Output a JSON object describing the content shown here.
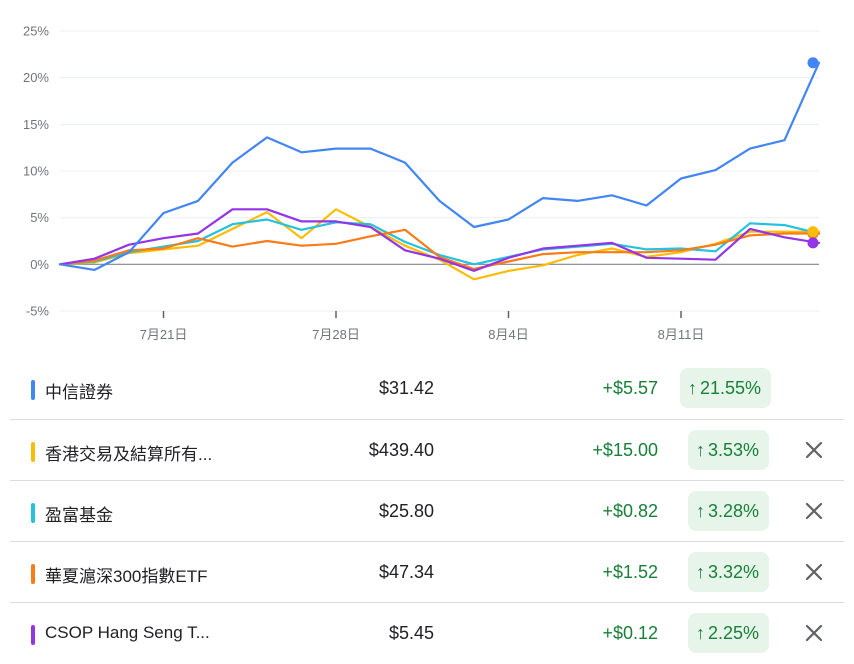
{
  "chart_data": {
    "type": "line",
    "y_tick_labels": [
      "25%",
      "20%",
      "15%",
      "10%",
      "5%",
      "0%",
      "-5%"
    ],
    "y_ticks": [
      25,
      20,
      15,
      10,
      5,
      0,
      -5
    ],
    "ylim": [
      -5,
      25
    ],
    "x_tick_labels": [
      "7月21日",
      "7月28日",
      "8月4日",
      "8月11日"
    ],
    "x_tick_index": [
      3,
      8,
      13,
      18
    ],
    "x_count": 23,
    "grid": true,
    "series": [
      {
        "name": "中信證券",
        "color": "#4285f4",
        "values": [
          0,
          -0.6,
          1.3,
          5.5,
          6.8,
          10.9,
          13.6,
          12.0,
          12.4,
          12.4,
          10.9,
          6.8,
          4.0,
          4.8,
          7.1,
          6.8,
          7.4,
          6.3,
          9.2,
          10.1,
          12.4,
          13.3,
          21.6
        ]
      },
      {
        "name": "香港交易及結算所有...",
        "color": "#fbbc04",
        "values": [
          0,
          0.2,
          1.2,
          1.6,
          2.0,
          3.8,
          5.6,
          2.8,
          5.9,
          4.0,
          2.0,
          0.5,
          -1.6,
          -0.7,
          -0.1,
          1.0,
          1.7,
          0.8,
          1.3,
          2.2,
          3.5,
          3.5,
          3.5
        ]
      },
      {
        "name": "盈富基金",
        "color": "#24c1e0",
        "values": [
          0,
          0.3,
          1.3,
          1.9,
          2.5,
          4.3,
          4.8,
          3.7,
          4.5,
          4.3,
          2.4,
          1.0,
          0.0,
          0.8,
          1.6,
          1.9,
          2.2,
          1.6,
          1.7,
          1.4,
          4.4,
          4.2,
          3.3
        ]
      },
      {
        "name": "華夏滬深300指數ETF",
        "color": "#fa7b17",
        "values": [
          0,
          0.4,
          1.5,
          1.7,
          2.8,
          1.9,
          2.5,
          2.0,
          2.2,
          3.0,
          3.7,
          0.8,
          -0.5,
          0.3,
          1.1,
          1.3,
          1.3,
          1.3,
          1.5,
          2.1,
          3.1,
          3.3,
          3.3
        ]
      },
      {
        "name": "CSOP Hang Seng T...",
        "color": "#9334e6",
        "values": [
          0,
          0.6,
          2.1,
          2.8,
          3.3,
          5.9,
          5.9,
          4.6,
          4.6,
          4.0,
          1.5,
          0.6,
          -0.7,
          0.7,
          1.7,
          2.0,
          2.3,
          0.7,
          0.6,
          0.5,
          3.8,
          2.9,
          2.3
        ]
      }
    ]
  },
  "stocks": [
    {
      "name": "中信證券",
      "price": "$31.42",
      "change": "+$5.57",
      "percent": "21.55%",
      "color": "#4285f4",
      "removable": false
    },
    {
      "name": "香港交易及結算所有...",
      "price": "$439.40",
      "change": "+$15.00",
      "percent": "3.53%",
      "color": "#fbbc04",
      "removable": true
    },
    {
      "name": "盈富基金",
      "price": "$25.80",
      "change": "+$0.82",
      "percent": "3.28%",
      "color": "#24c1e0",
      "removable": true
    },
    {
      "name": "華夏滬深300指數ETF",
      "price": "$47.34",
      "change": "+$1.52",
      "percent": "3.32%",
      "color": "#fa7b17",
      "removable": true
    },
    {
      "name": "CSOP Hang Seng T...",
      "price": "$5.45",
      "change": "+$0.12",
      "percent": "2.25%",
      "color": "#9334e6",
      "removable": true
    }
  ],
  "icons": {
    "up": "arrow-up-icon",
    "remove": "close-icon"
  }
}
